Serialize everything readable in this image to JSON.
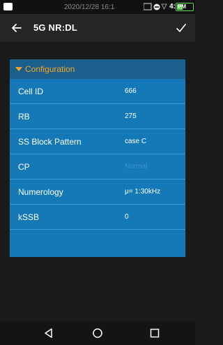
{
  "status_bar": {
    "datetime": "2020/12/28 16:1",
    "time": "4:1",
    "battery_label": "PM",
    "battery_level": 0.35
  },
  "app_bar": {
    "title": "5G NR:DL"
  },
  "section": {
    "title": "Configuration"
  },
  "fields": [
    {
      "label": "Cell ID",
      "value": "666",
      "disabled": false
    },
    {
      "label": "RB",
      "value": "275",
      "disabled": false
    },
    {
      "label": "SS Block Pattern",
      "value": "case C",
      "disabled": false
    },
    {
      "label": "CP",
      "value": "Normal",
      "disabled": true
    },
    {
      "label": "Numerology",
      "value": "μ= 1:30kHz",
      "disabled": false
    },
    {
      "label": "kSSB",
      "value": "0",
      "disabled": false
    }
  ],
  "colors": {
    "panel": "#1579b8",
    "header": "#1b5f8c",
    "accent": "#f3a52a"
  }
}
